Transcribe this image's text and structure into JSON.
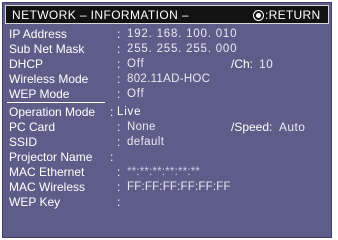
{
  "header": {
    "title": "NETWORK – INFORMATION –",
    "return_label": ":RETURN",
    "return_icon": "circle-button-icon"
  },
  "items": [
    {
      "label": "IP Address",
      "value": "192. 168. 100. 010"
    },
    {
      "label": "Sub Net Mask",
      "value": "255. 255. 255. 000"
    },
    {
      "label": "DHCP",
      "value": "Off",
      "aux_label": "/Ch:",
      "aux_value": "10"
    },
    {
      "label": "Wireless Mode",
      "value": "802.11AD-HOC"
    },
    {
      "label": "WEP Mode",
      "value": "Off"
    },
    {
      "label": "Operation Mode",
      "value": "Live"
    },
    {
      "label": "PC Card",
      "value": "None",
      "aux_label": "/Speed:",
      "aux_value": "Auto"
    },
    {
      "label": "SSID",
      "value": "default"
    },
    {
      "label": "Projector Name",
      "value": ""
    },
    {
      "label": "MAC Ethernet",
      "value": "**:**:**:**:**:**"
    },
    {
      "label": "MAC Wireless",
      "value": "FF:FF:FF:FF:FF:FF"
    },
    {
      "label": "WEP Key",
      "value": ""
    }
  ],
  "colors": {
    "panel": "#5e5d8a",
    "titlebar": "#121212",
    "text": "#ffffff"
  }
}
